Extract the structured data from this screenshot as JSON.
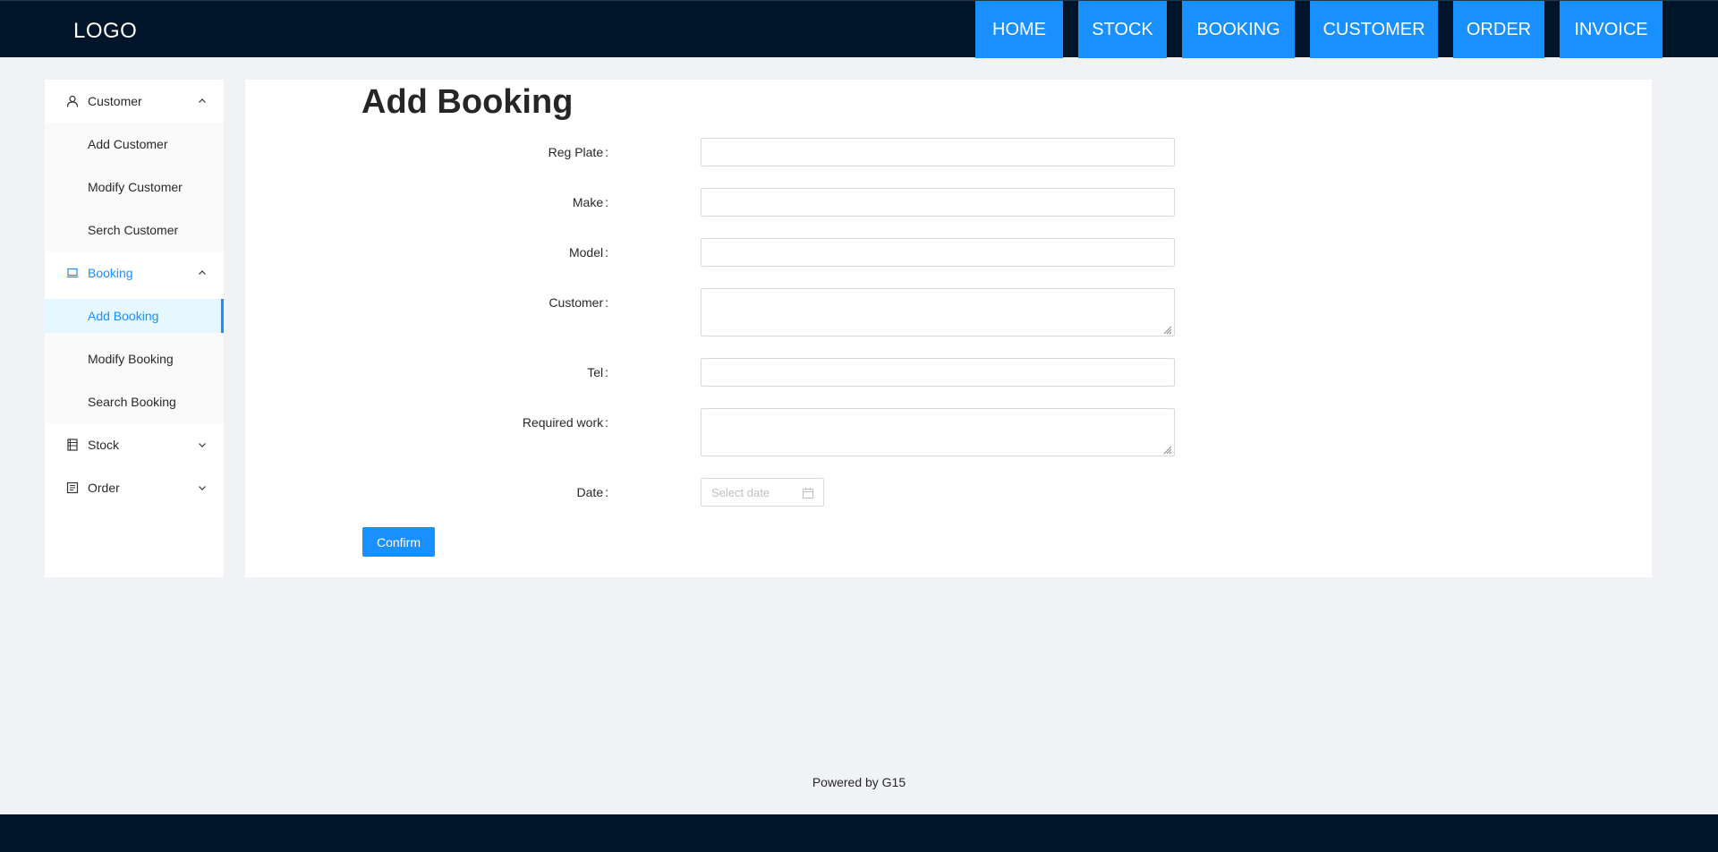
{
  "header": {
    "logo": "LOGO",
    "nav": [
      "HOME",
      "STOCK",
      "BOOKING",
      "CUSTOMER",
      "ORDER",
      "INVOICE"
    ]
  },
  "sidebar": {
    "groups": [
      {
        "label": "Customer",
        "icon": "user-icon",
        "expanded": true,
        "items": [
          "Add Customer",
          "Modify Customer",
          "Serch Customer"
        ]
      },
      {
        "label": "Booking",
        "icon": "laptop-icon",
        "expanded": true,
        "active": true,
        "items": [
          "Add Booking",
          "Modify Booking",
          "Search Booking"
        ],
        "selected": "Add Booking"
      },
      {
        "label": "Stock",
        "icon": "book-icon",
        "expanded": false
      },
      {
        "label": "Order",
        "icon": "order-icon",
        "expanded": false
      }
    ]
  },
  "main": {
    "title": "Add Booking",
    "fields": {
      "reg_plate": {
        "label": "Reg Plate",
        "value": ""
      },
      "make": {
        "label": "Make",
        "value": ""
      },
      "model": {
        "label": "Model",
        "value": ""
      },
      "customer": {
        "label": "Customer",
        "value": ""
      },
      "tel": {
        "label": "Tel",
        "value": ""
      },
      "required_work": {
        "label": "Required work",
        "value": ""
      },
      "date": {
        "label": "Date",
        "placeholder": "Select date"
      }
    },
    "confirm_label": "Confirm"
  },
  "footer": {
    "text": "Powered by G15"
  },
  "colors": {
    "header_bg": "#001529",
    "accent": "#1890ff",
    "page_bg": "#f0f2f5",
    "selected_bg": "#e6f7ff"
  }
}
